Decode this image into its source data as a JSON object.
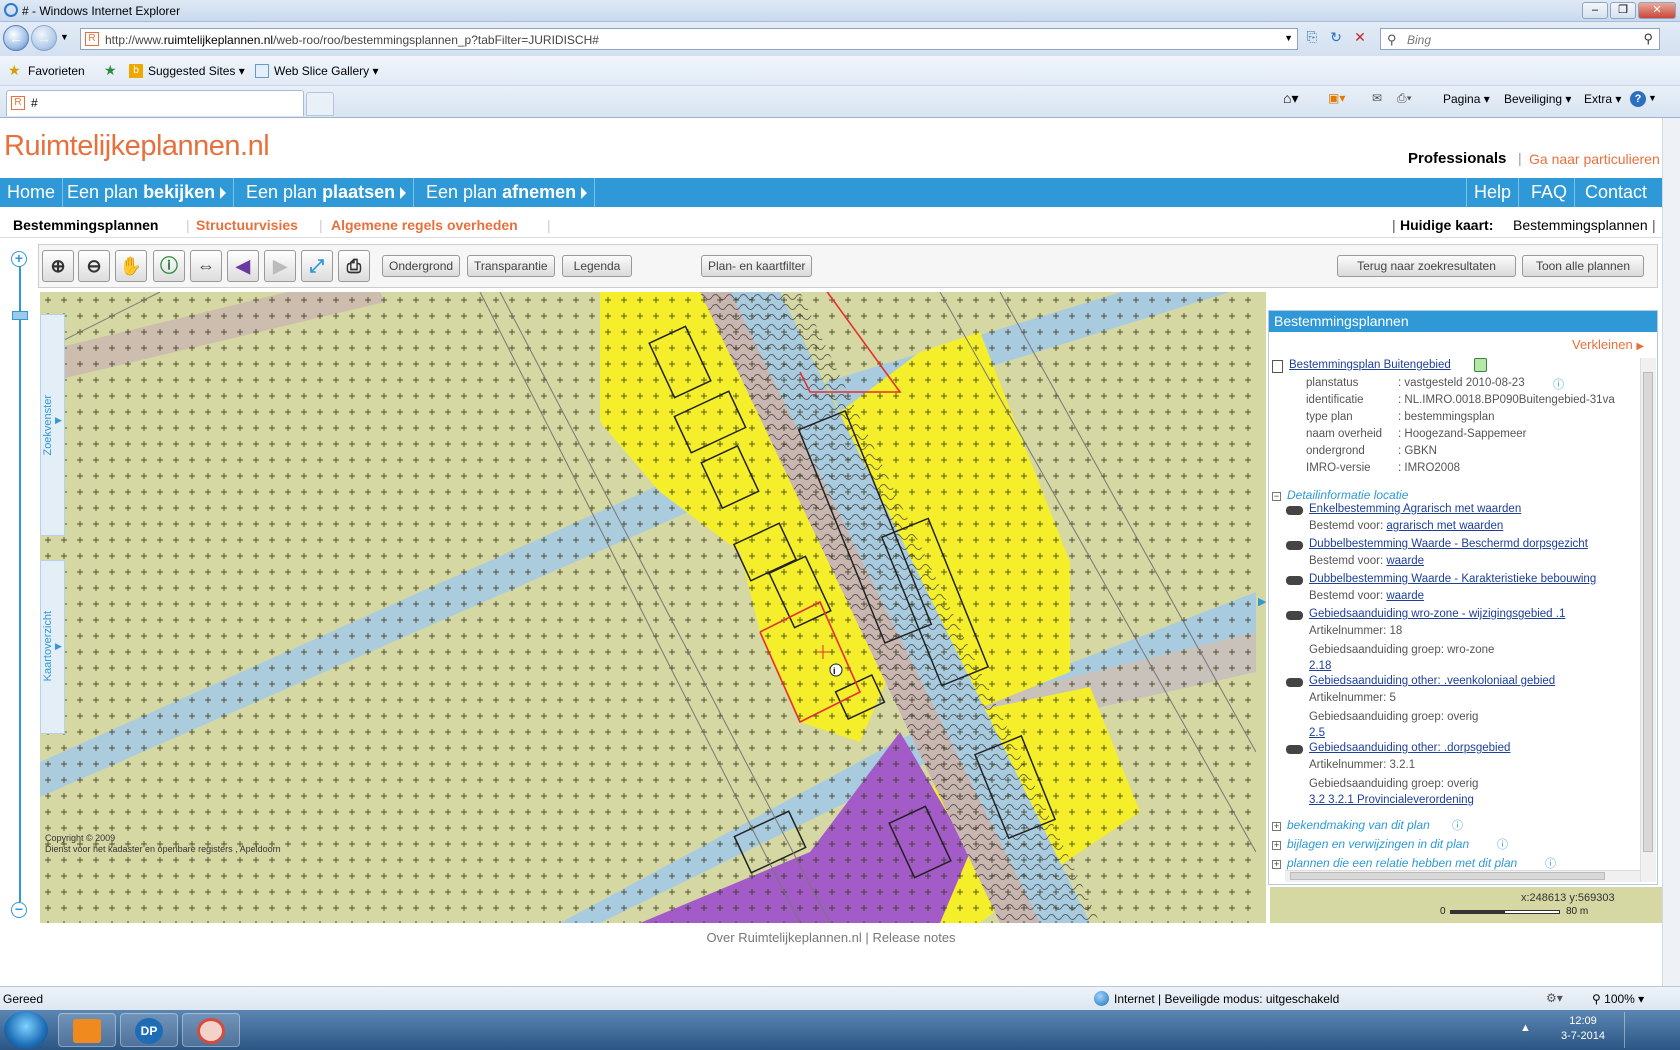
{
  "window": {
    "title": "# - Windows Internet Explorer"
  },
  "browser": {
    "url_prefix": "http://www.",
    "url_domain": "ruimtelijkeplannen.nl",
    "url_path": "/web-roo/roo/bestemmingsplannen_p?tabFilter=JURIDISCH#",
    "search_placeholder": "Bing",
    "favorites": [
      "Favorieten",
      "Suggested Sites ▾",
      "Web Slice Gallery ▾"
    ],
    "tab_title": "#",
    "commands": [
      "Pagina ▾",
      "Beveiliging ▾",
      "Extra ▾"
    ]
  },
  "site": {
    "logo": "Ruimtelijkeplannen.nl",
    "professionals": "Professionals",
    "separator": "|",
    "particulieren": "Ga naar particulieren"
  },
  "mainnav": {
    "home": "Home",
    "items": [
      {
        "pre": "Een plan ",
        "bold": "bekijken"
      },
      {
        "pre": "Een plan ",
        "bold": "plaatsen"
      },
      {
        "pre": "Een plan ",
        "bold": "afnemen"
      }
    ],
    "right": [
      "Help",
      "FAQ",
      "Contact"
    ]
  },
  "subnav": {
    "items": [
      "Bestemmingsplannen",
      "Structuurvisies",
      "Algemene regels overheden"
    ],
    "current_label": "Huidige kaart:",
    "current_value": "Bestemmingsplannen"
  },
  "toolbar": {
    "buttons": [
      "Ondergrond",
      "Transparantie",
      "Legenda",
      "Plan- en kaartfilter"
    ],
    "right_buttons": [
      "Terug naar zoekresultaten",
      "Toon alle plannen"
    ]
  },
  "sidetabs": [
    "Zoekvenster",
    "Kaartoverzicht"
  ],
  "map": {
    "copyright": "Copyright © 2009",
    "copyright2": "Dienst voor het kadaster en openbare registers , Apeldoorn",
    "coords": "x:248613 y:569303",
    "scale_min": "0",
    "scale_max": "80 m"
  },
  "panel": {
    "title": "Bestemmingsplannen",
    "collapse": "Verkleinen",
    "plan_link": "Bestemmingsplan Buitengebied",
    "props": [
      {
        "label": "planstatus",
        "value": ": vastgesteld 2010-08-23"
      },
      {
        "label": "identificatie",
        "value": ": NL.IMRO.0018.BP090Buitengebied-31va"
      },
      {
        "label": "type plan",
        "value": ": bestemmingsplan"
      },
      {
        "label": "naam overheid",
        "value": ": Hoogezand-Sappemeer"
      },
      {
        "label": "ondergrond",
        "value": ": GBKN"
      },
      {
        "label": "IMRO-versie",
        "value": ": IMRO2008"
      }
    ],
    "detail_title": "Detailinformatie locatie",
    "details": [
      {
        "link": "Enkelbestemming Agrarisch met waarden",
        "sub_label": "Bestemd voor: ",
        "sub_link": "agrarisch met waarden"
      },
      {
        "link": "Dubbelbestemming Waarde - Beschermd dorpsgezicht",
        "sub_label": "Bestemd voor: ",
        "sub_link": "waarde"
      },
      {
        "link": "Dubbelbestemming Waarde - Karakteristieke bebouwing",
        "sub_label": "Bestemd voor: ",
        "sub_link": "waarde"
      },
      {
        "link": "Gebiedsaanduiding wro-zone - wijzigingsgebied .1",
        "line1": "Artikelnummer: 18",
        "line2": "Gebiedsaanduiding groep: wro-zone",
        "sub_link": "2.18"
      },
      {
        "link": "Gebiedsaanduiding other: .veenkoloniaal gebied",
        "line1": "Artikelnummer: 5",
        "line2": "Gebiedsaanduiding groep: overig",
        "sub_link": "2.5"
      },
      {
        "link": "Gebiedsaanduiding other: .dorpsgebied",
        "line1": "Artikelnummer: 3.2.1",
        "line2": "Gebiedsaanduiding groep: overig",
        "sub_link": "3.2 3.2.1 Provincialeverordening"
      }
    ],
    "sections": [
      "bekendmaking van dit plan",
      "bijlagen en verwijzingen in dit plan",
      "plannen die een relatie hebben met dit plan"
    ]
  },
  "footer": {
    "about": "Over Ruimtelijkeplannen.nl",
    "sep": "|",
    "release": "Release notes"
  },
  "statusbar": {
    "left": "Gereed",
    "zone": "Internet | Beveiligde modus: uitgeschakeld",
    "zoom": "100% ▾"
  },
  "taskbar": {
    "time": "12:09",
    "date": "3-7-2014"
  },
  "colors": {
    "brand_orange": "#e8703c",
    "brand_blue": "#2f99d7",
    "zone_yellow": "#f5ee2a",
    "zone_purple": "#a35bc7",
    "zone_green": "#d6d8a4"
  }
}
